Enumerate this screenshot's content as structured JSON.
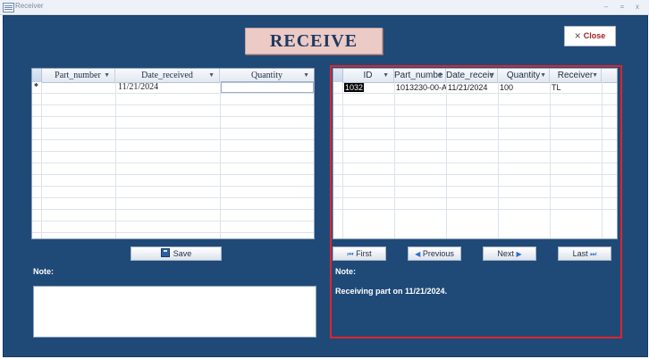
{
  "window": {
    "title": "Receiver",
    "minimize": "–",
    "restore": "=",
    "close": "x"
  },
  "header": {
    "title": "RECEIVE",
    "close_label": "Close",
    "close_icon": "×"
  },
  "left_grid": {
    "columns": [
      "Part_number",
      "Date_received",
      "Quantity"
    ],
    "new_row_marker": "*",
    "rows": [
      {
        "part_number": "",
        "date_received": "11/21/2024",
        "quantity": ""
      }
    ]
  },
  "save_button": {
    "label": "Save"
  },
  "left_note": {
    "label": "Note:",
    "value": ""
  },
  "right_grid": {
    "columns": [
      "ID",
      "Part_numbe",
      "Date_receiv",
      "Quantity",
      "Receiver"
    ],
    "rows": [
      {
        "id": "1032",
        "part_number": "1013230-00-A",
        "date_received": "11/21/2024",
        "quantity": "100",
        "receiver": "TL"
      }
    ]
  },
  "nav": {
    "first": "First",
    "previous": "Previous",
    "next": "Next",
    "last": "Last"
  },
  "right_note": {
    "label": "Note:",
    "text": "Receiving part on 11/21/2024."
  },
  "colors": {
    "background": "#1f4a78",
    "title_bg": "#eccac6",
    "highlight_border": "#e0242a"
  }
}
